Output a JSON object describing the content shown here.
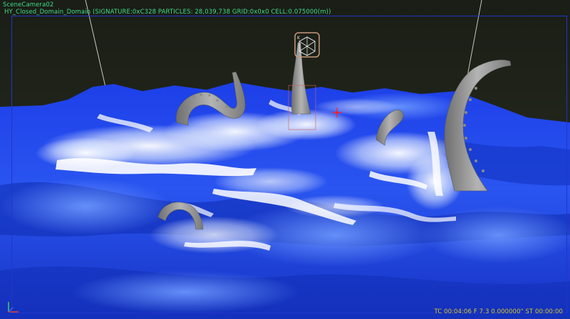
{
  "viewport": {
    "camera_name": "SceneCamera02",
    "domain_info": "HY_Closed_Domain_Domain (SIGNATURE:0xC328 PARTICLES: 28,039,738 GRID:0x0x0 CELL:0.075000(m))",
    "timecode": "TC 00:04:06  F 7.3 0.000000\"  ST 00:00:00"
  },
  "colors": {
    "hud_text": "#46e08e",
    "timecode_text": "#d8d05a",
    "safe_frame": "#2335c8",
    "sky": "#20241c",
    "water_deep": "#0a28c8",
    "water_light": "#3f74ff",
    "foam": "#ffffff",
    "tentacle": "#9a9a9a",
    "emitter_locator": "#c89a7a",
    "selection_marker": "#ff2020"
  },
  "objects": {
    "tentacles": [
      "tentacle-left",
      "tentacle-center",
      "tentacle-right",
      "tentacle-small-right",
      "tentacle-front"
    ],
    "emitter_icon": "cube-locator-icon",
    "gizmo_icon": "axis-gizmo-icon"
  }
}
